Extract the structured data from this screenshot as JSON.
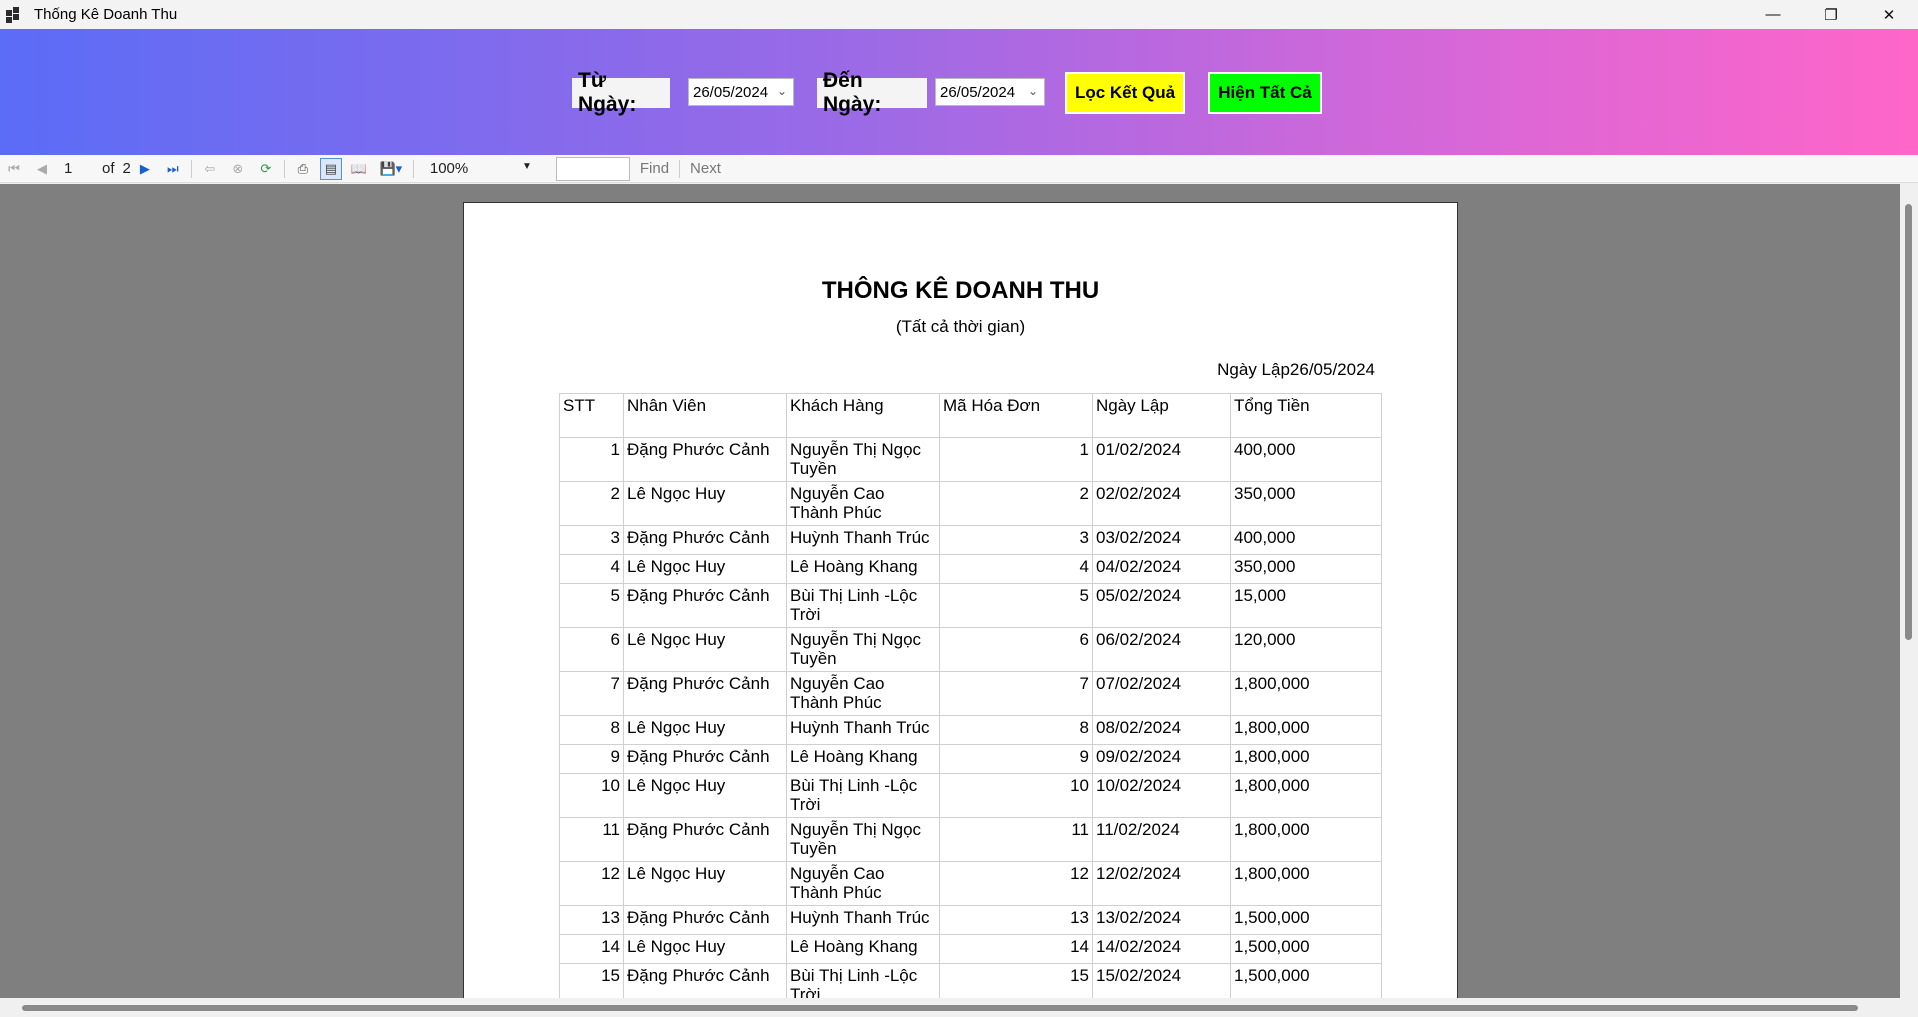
{
  "window": {
    "title": "Thống Kê Doanh Thu",
    "minimize": "—",
    "restore": "❐",
    "close": "✕"
  },
  "filter": {
    "from_label": "Từ Ngày:",
    "from_value": "26/05/2024",
    "to_label": "Đến Ngày:",
    "to_value": "26/05/2024",
    "filter_button": "Lọc Kết Quả",
    "show_all_button": "Hiện Tất Cả",
    "filter_button_color": "#ffff00",
    "show_all_button_color": "#00ff00"
  },
  "toolbar": {
    "current_page": "1",
    "of_label": "of",
    "total_pages": "2",
    "zoom": "100%",
    "find_label": "Find",
    "next_label": "Next"
  },
  "report": {
    "title": "THÔNG KÊ DOANH THU",
    "subtitle": "(Tất cả thời gian)",
    "date_label": "Ngày Lập26/05/2024",
    "headers": [
      "STT",
      "Nhân Viên",
      "Khách Hàng",
      "Mã Hóa Đơn",
      "Ngày Lập",
      "Tổng Tiền"
    ],
    "rows": [
      {
        "stt": "1",
        "employee": "Đặng Phước Cảnh",
        "customer": "Nguyễn Thị Ngọc Tuyền",
        "invoice": "1",
        "date": "01/02/2024",
        "total": "400,000"
      },
      {
        "stt": "2",
        "employee": "Lê Ngọc Huy",
        "customer": "Nguyễn Cao Thành Phúc",
        "invoice": "2",
        "date": "02/02/2024",
        "total": "350,000"
      },
      {
        "stt": "3",
        "employee": "Đặng Phước Cảnh",
        "customer": "Huỳnh Thanh Trúc",
        "invoice": "3",
        "date": "03/02/2024",
        "total": "400,000"
      },
      {
        "stt": "4",
        "employee": "Lê Ngọc Huy",
        "customer": "Lê Hoàng Khang",
        "invoice": "4",
        "date": "04/02/2024",
        "total": "350,000"
      },
      {
        "stt": "5",
        "employee": "Đặng Phước Cảnh",
        "customer": "Bùi Thị Linh -Lộc Trời",
        "invoice": "5",
        "date": "05/02/2024",
        "total": "15,000"
      },
      {
        "stt": "6",
        "employee": "Lê Ngọc Huy",
        "customer": "Nguyễn Thị Ngọc Tuyền",
        "invoice": "6",
        "date": "06/02/2024",
        "total": "120,000"
      },
      {
        "stt": "7",
        "employee": "Đặng Phước Cảnh",
        "customer": "Nguyễn Cao Thành Phúc",
        "invoice": "7",
        "date": "07/02/2024",
        "total": "1,800,000"
      },
      {
        "stt": "8",
        "employee": "Lê Ngọc Huy",
        "customer": "Huỳnh Thanh Trúc",
        "invoice": "8",
        "date": "08/02/2024",
        "total": "1,800,000"
      },
      {
        "stt": "9",
        "employee": "Đặng Phước Cảnh",
        "customer": "Lê Hoàng Khang",
        "invoice": "9",
        "date": "09/02/2024",
        "total": "1,800,000"
      },
      {
        "stt": "10",
        "employee": "Lê Ngọc Huy",
        "customer": "Bùi Thị Linh -Lộc Trời",
        "invoice": "10",
        "date": "10/02/2024",
        "total": "1,800,000"
      },
      {
        "stt": "11",
        "employee": "Đặng Phước Cảnh",
        "customer": "Nguyễn Thị Ngọc Tuyền",
        "invoice": "11",
        "date": "11/02/2024",
        "total": "1,800,000"
      },
      {
        "stt": "12",
        "employee": "Lê Ngọc Huy",
        "customer": "Nguyễn Cao Thành Phúc",
        "invoice": "12",
        "date": "12/02/2024",
        "total": "1,800,000"
      },
      {
        "stt": "13",
        "employee": "Đặng Phước Cảnh",
        "customer": "Huỳnh Thanh Trúc",
        "invoice": "13",
        "date": "13/02/2024",
        "total": "1,500,000"
      },
      {
        "stt": "14",
        "employee": "Lê Ngọc Huy",
        "customer": "Lê Hoàng Khang",
        "invoice": "14",
        "date": "14/02/2024",
        "total": "1,500,000"
      },
      {
        "stt": "15",
        "employee": "Đặng Phước Cảnh",
        "customer": "Bùi Thị Linh -Lộc Trời",
        "invoice": "15",
        "date": "15/02/2024",
        "total": "1,500,000"
      }
    ]
  }
}
